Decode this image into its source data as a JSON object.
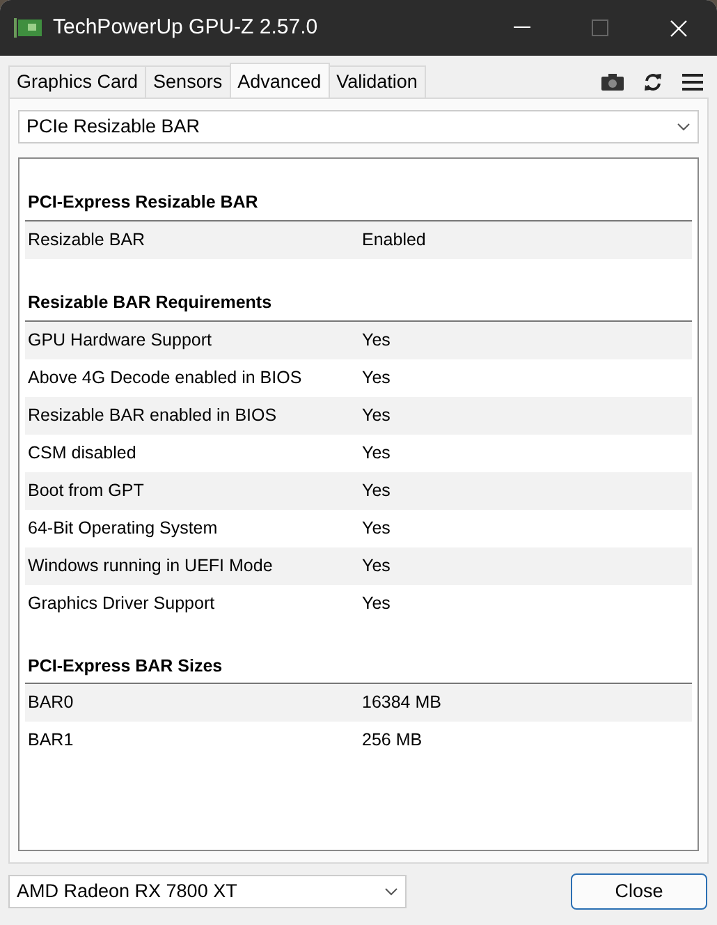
{
  "window": {
    "title": "TechPowerUp GPU-Z 2.57.0"
  },
  "tabs": [
    {
      "label": "Graphics Card",
      "selected": false
    },
    {
      "label": "Sensors",
      "selected": false
    },
    {
      "label": "Advanced",
      "selected": true
    },
    {
      "label": "Validation",
      "selected": false
    }
  ],
  "view_select": {
    "value": "PCIe Resizable BAR"
  },
  "sections": [
    {
      "title": "PCI-Express Resizable BAR",
      "rows": [
        {
          "label": "Resizable BAR",
          "value": "Enabled"
        }
      ]
    },
    {
      "title": "Resizable BAR Requirements",
      "rows": [
        {
          "label": "GPU Hardware Support",
          "value": "Yes"
        },
        {
          "label": "Above 4G Decode enabled in BIOS",
          "value": "Yes"
        },
        {
          "label": "Resizable BAR enabled in BIOS",
          "value": "Yes"
        },
        {
          "label": "CSM disabled",
          "value": "Yes"
        },
        {
          "label": "Boot from GPT",
          "value": "Yes"
        },
        {
          "label": "64-Bit Operating System",
          "value": "Yes"
        },
        {
          "label": "Windows running in UEFI Mode",
          "value": "Yes"
        },
        {
          "label": "Graphics Driver Support",
          "value": "Yes"
        }
      ]
    },
    {
      "title": "PCI-Express BAR Sizes",
      "rows": [
        {
          "label": "BAR0",
          "value": "16384 MB"
        },
        {
          "label": "BAR1",
          "value": "256 MB"
        }
      ]
    }
  ],
  "gpu_select": {
    "value": "AMD Radeon RX 7800 XT"
  },
  "close_button": {
    "label": "Close"
  }
}
